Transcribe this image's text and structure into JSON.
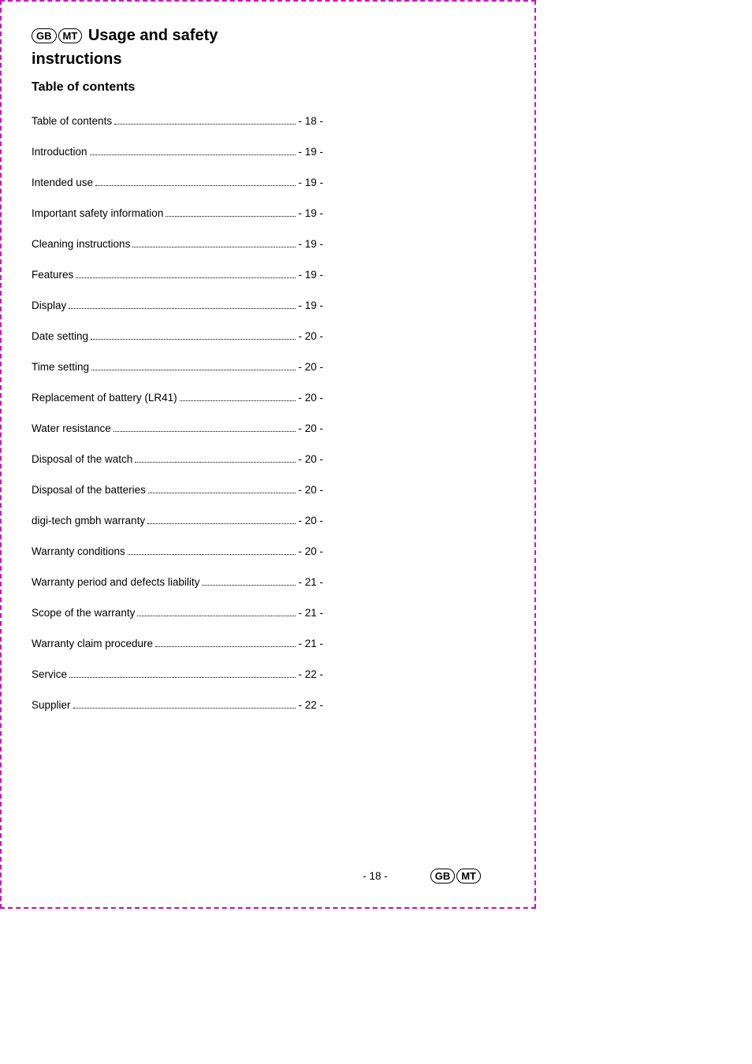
{
  "header": {
    "badge1": "GB",
    "badge2": "MT",
    "title_rest": " Usage and safety",
    "title_line2": "instructions"
  },
  "subtitle": "Table of contents",
  "toc": [
    {
      "label": "Table of contents",
      "page": "- 18 -"
    },
    {
      "label": "Introduction",
      "page": "- 19 -"
    },
    {
      "label": "Intended use",
      "page": "- 19 -"
    },
    {
      "label": "Important safety information",
      "page": "- 19 -"
    },
    {
      "label": "Cleaning instructions",
      "page": "- 19 -"
    },
    {
      "label": "Features",
      "page": "- 19 -"
    },
    {
      "label": "Display",
      "page": "- 19 -"
    },
    {
      "label": "Date setting",
      "page": "- 20 -"
    },
    {
      "label": "Time setting",
      "page": "- 20 -"
    },
    {
      "label": "Replacement of battery (LR41)",
      "page": "- 20 -"
    },
    {
      "label": "Water resistance",
      "page": "- 20 -"
    },
    {
      "label": "Disposal of the watch",
      "page": "- 20 -"
    },
    {
      "label": "Disposal of the batteries",
      "page": "- 20 -"
    },
    {
      "label": "digi-tech gmbh warranty",
      "page": "- 20 -"
    },
    {
      "label": "Warranty conditions",
      "page": "- 20 -"
    },
    {
      "label": "Warranty period and defects liability",
      "page": "- 21 -"
    },
    {
      "label": "Scope of the warranty",
      "page": "- 21 -"
    },
    {
      "label": "Warranty claim procedure",
      "page": "- 21 -"
    },
    {
      "label": "Service",
      "page": "- 22 -"
    },
    {
      "label": "Supplier",
      "page": "- 22 -"
    }
  ],
  "footer": {
    "page_number": "- 18 -",
    "badge1": "GB",
    "badge2": "MT"
  }
}
